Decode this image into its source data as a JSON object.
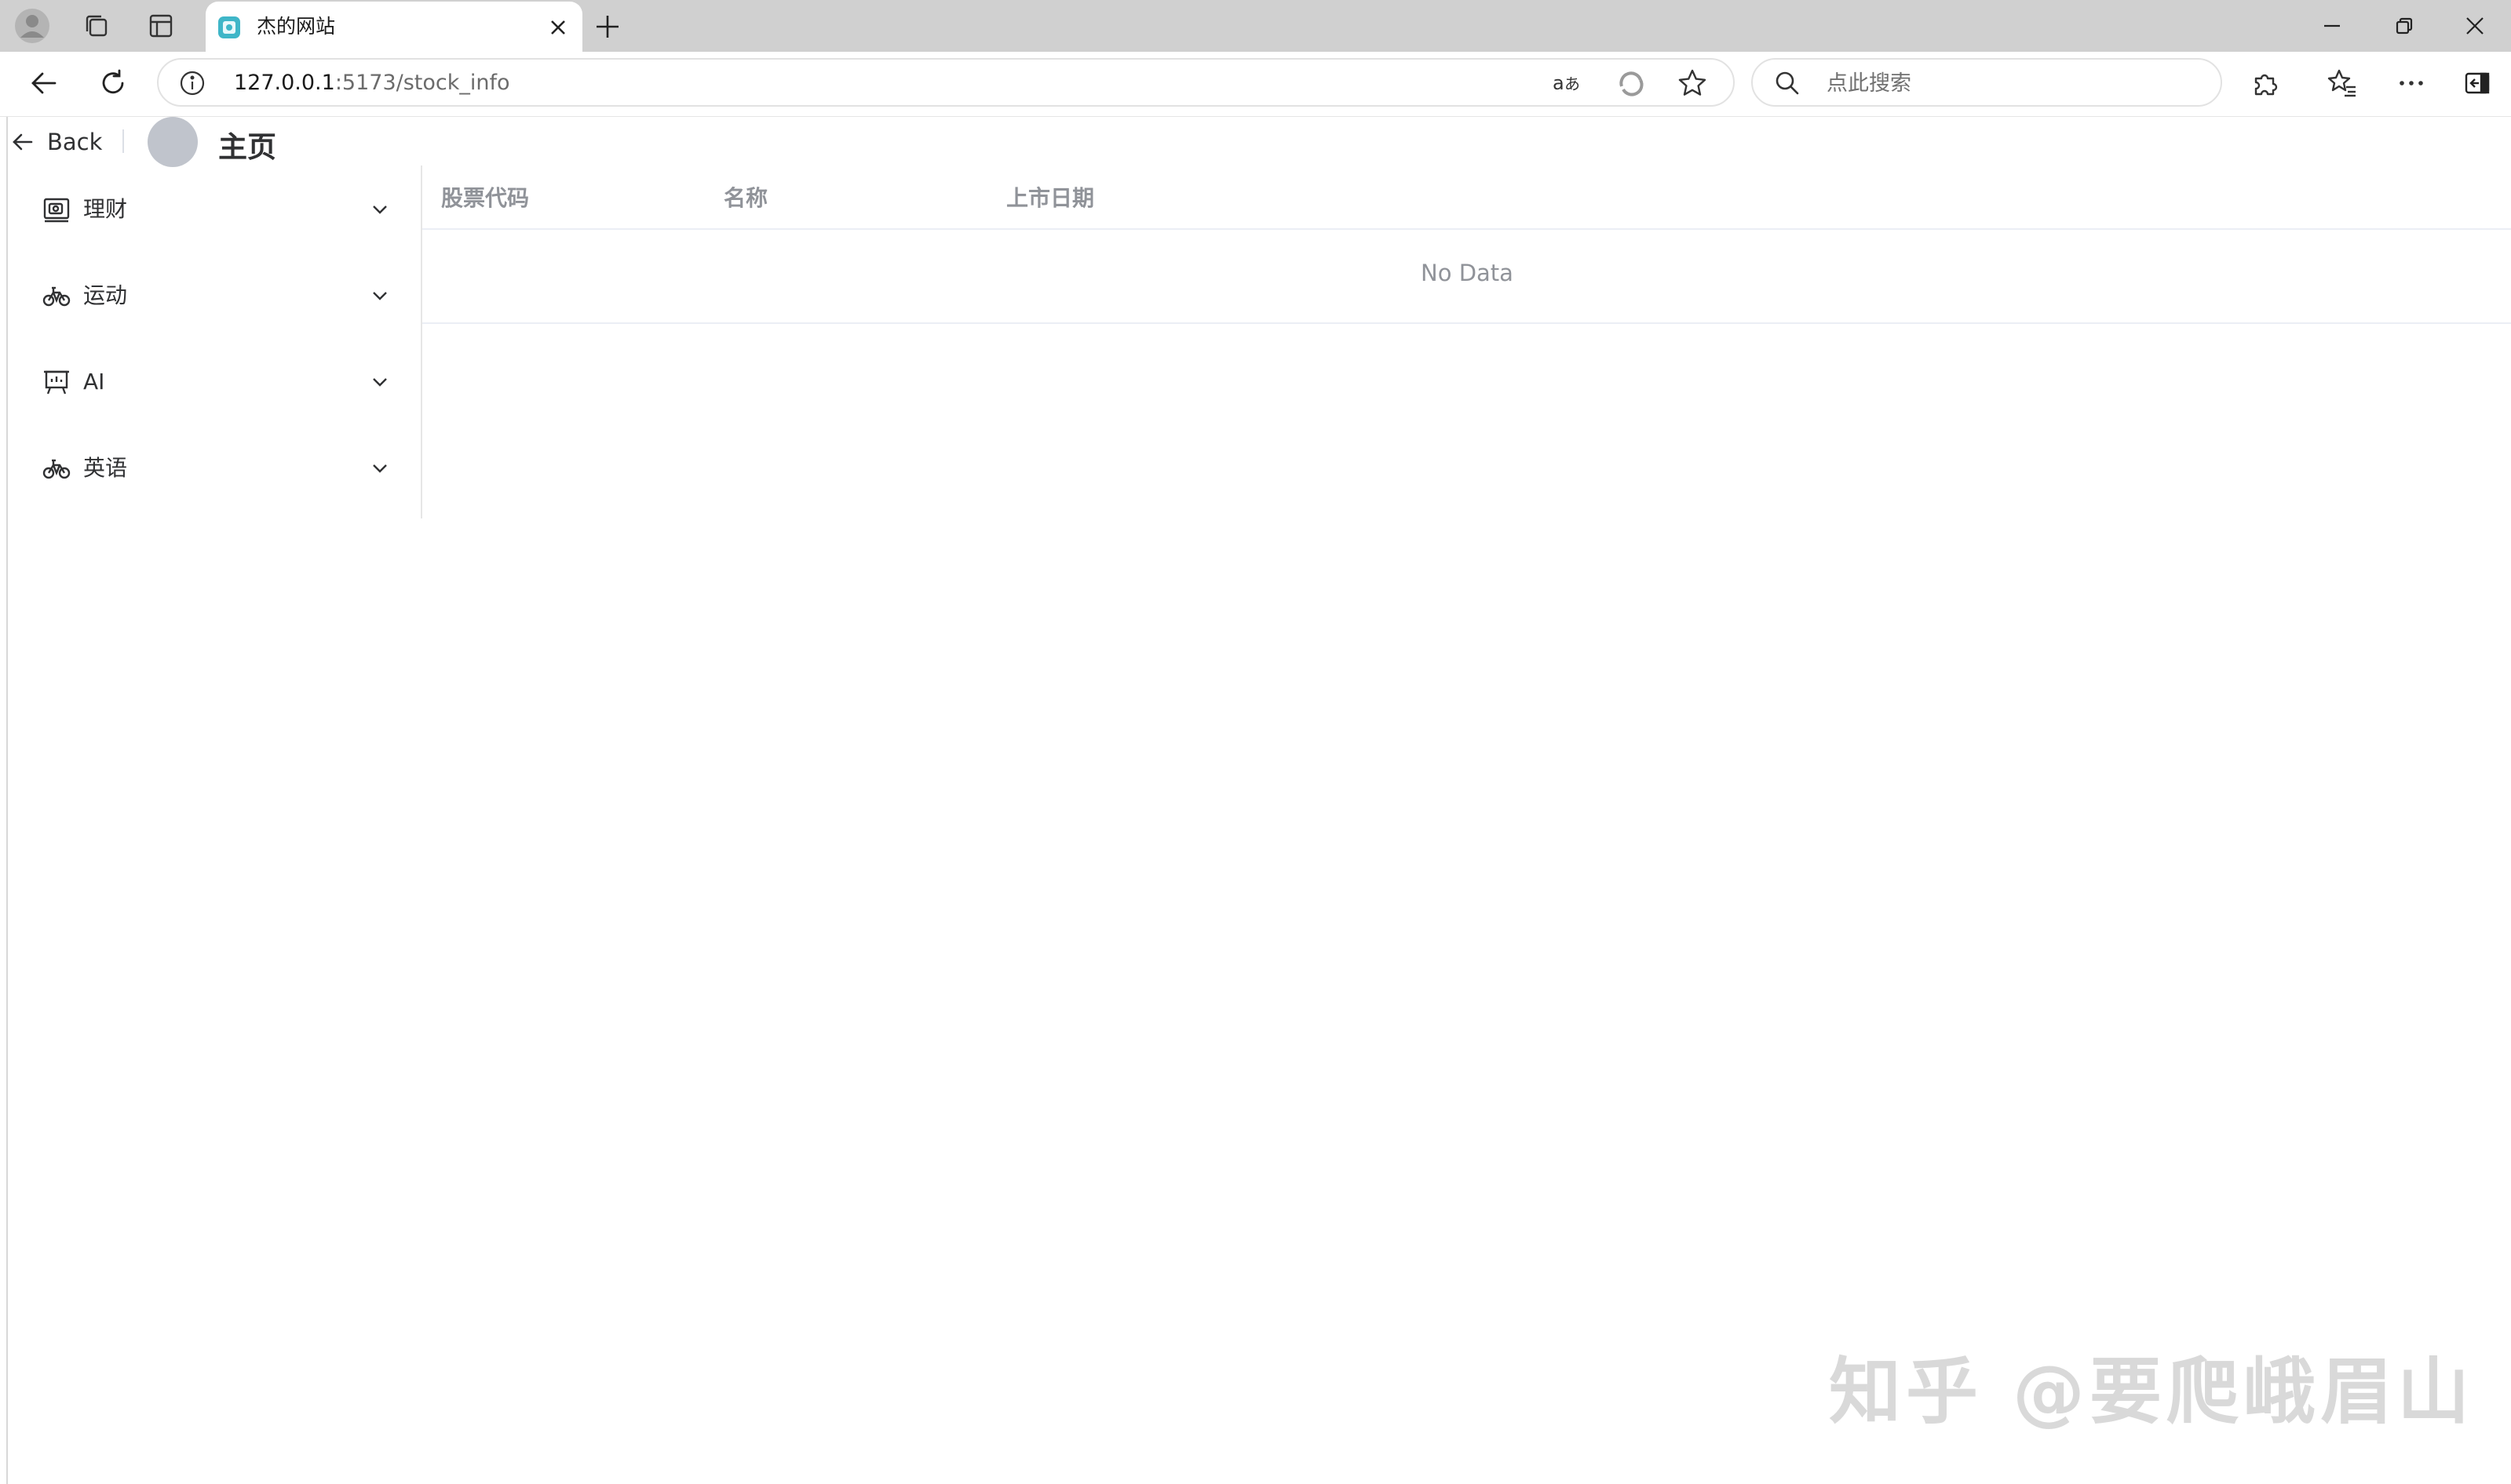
{
  "browser": {
    "tab": {
      "title": "杰的网站"
    },
    "address": {
      "host": "127.0.0.1",
      "path": ":5173/stock_info"
    },
    "search": {
      "placeholder": "点此搜索"
    },
    "icons": [
      "profile-icon",
      "collections-icon",
      "tab-actions-icon",
      "tab-favicon",
      "tab-close-icon",
      "new-tab-icon",
      "minimize-icon",
      "restore-icon",
      "window-close-icon",
      "back-arrow-icon",
      "refresh-icon",
      "site-info-icon",
      "read-aloud-icon",
      "copilot-icon",
      "favorite-star-icon",
      "search-icon",
      "extensions-icon",
      "favorites-icon",
      "more-icon",
      "sidebar-toggle-icon"
    ]
  },
  "page": {
    "back_label": "Back",
    "title": "主页"
  },
  "sidebar": {
    "items": [
      {
        "label": "理财",
        "icon": "wallet-icon"
      },
      {
        "label": "运动",
        "icon": "bicycle-icon"
      },
      {
        "label": "AI",
        "icon": "presentation-icon"
      },
      {
        "label": "英语",
        "icon": "bicycle-icon"
      }
    ]
  },
  "table": {
    "columns": [
      "股票代码",
      "名称",
      "上市日期"
    ],
    "rows": [],
    "empty_text": "No Data"
  },
  "watermark": {
    "text": "知乎 @要爬峨眉山"
  },
  "colors": {
    "tabstrip": "#d0d0d0",
    "header_text": "#909399",
    "border": "#ebeef5",
    "avatar": "#c0c4cc"
  }
}
